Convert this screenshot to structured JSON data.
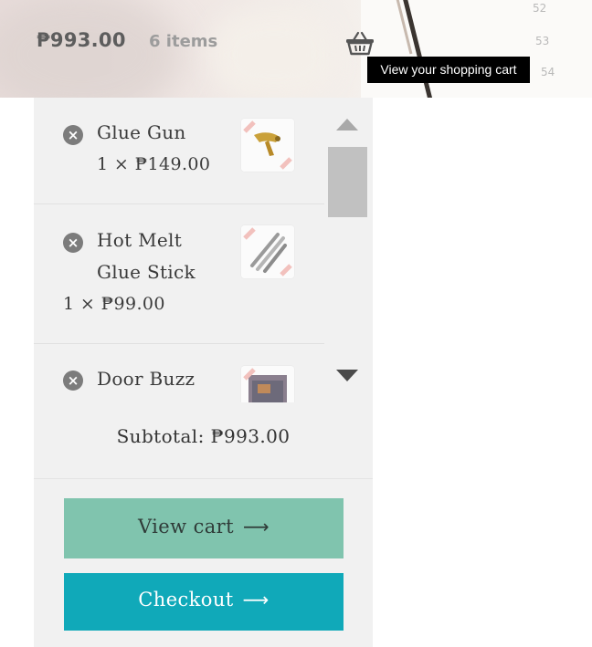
{
  "header": {
    "cart_total": "₱993.00",
    "cart_count": "6 items",
    "cart_icon": "basket-icon",
    "tooltip": "View your shopping cart",
    "background_page_numbers": [
      "52",
      "53",
      "54"
    ]
  },
  "mini_cart": {
    "items": [
      {
        "name_line1": "Glue Gun",
        "name_line2": "",
        "quantity": "1 × ₱149.00"
      },
      {
        "name_line1": "Hot Melt",
        "name_line2": "Glue Stick",
        "quantity": "1 × ₱99.00"
      },
      {
        "name_line1": "Door Buzz",
        "name_line2": "",
        "quantity": ""
      }
    ],
    "remove_icon": "remove-circle-icon",
    "subtotal": "Subtotal: ₱993.00",
    "buttons": {
      "view_cart": "View cart",
      "checkout": "Checkout",
      "arrow": "⟶"
    }
  },
  "colors": {
    "view_cart_bg": "#80c4ae",
    "checkout_bg": "#10a9b9",
    "panel_bg": "#f1f1f1",
    "tooltip_bg": "#000000"
  }
}
